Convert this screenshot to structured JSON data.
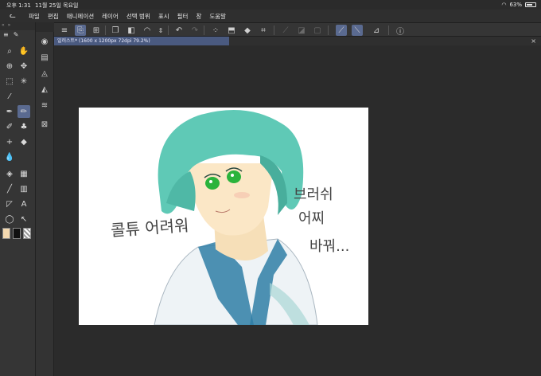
{
  "status_bar": {
    "time": "오후 1:31",
    "date": "11월 25일 목요일",
    "battery": "63%"
  },
  "menu": {
    "items": [
      "파일",
      "편집",
      "애니메이션",
      "레이어",
      "선택 범위",
      "표시",
      "필터",
      "창",
      "도움말"
    ]
  },
  "document": {
    "tab_title": "일러스트* (1600 x 1200px 72dpi 79.2%)"
  },
  "drawing_text": {
    "left": "콜튜 어려워",
    "right_line1": "브러쉬",
    "right_line2": "어찌",
    "right_line3": "바꿔..."
  },
  "colors": {
    "accent": "#5a6a90",
    "main_color": "#f4d9b0",
    "sub_color": "#111111"
  }
}
